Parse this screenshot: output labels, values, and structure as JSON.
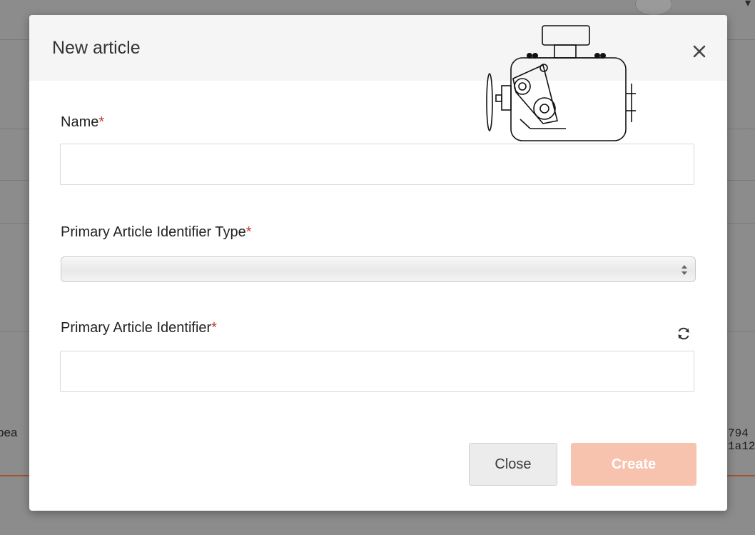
{
  "background": {
    "row_text_left": "bea",
    "row_text_right_line1": "794",
    "row_text_right_line2": "1a12"
  },
  "modal": {
    "title": "New article",
    "close_icon": "close-icon",
    "illustration": "engine-icon",
    "fields": {
      "name": {
        "label": "Name",
        "required_marker": "*",
        "value": ""
      },
      "identifier_type": {
        "label": "Primary Article Identifier Type",
        "required_marker": "*",
        "selected": ""
      },
      "identifier": {
        "label": "Primary Article Identifier",
        "required_marker": "*",
        "value": "",
        "refresh_icon": "refresh-icon"
      }
    },
    "buttons": {
      "close_label": "Close",
      "create_label": "Create"
    }
  },
  "colors": {
    "required": "#c0392b",
    "create_button_disabled": "#f7c2ae",
    "header_bg": "#f5f5f5",
    "overlay": "#8c8c8c"
  }
}
